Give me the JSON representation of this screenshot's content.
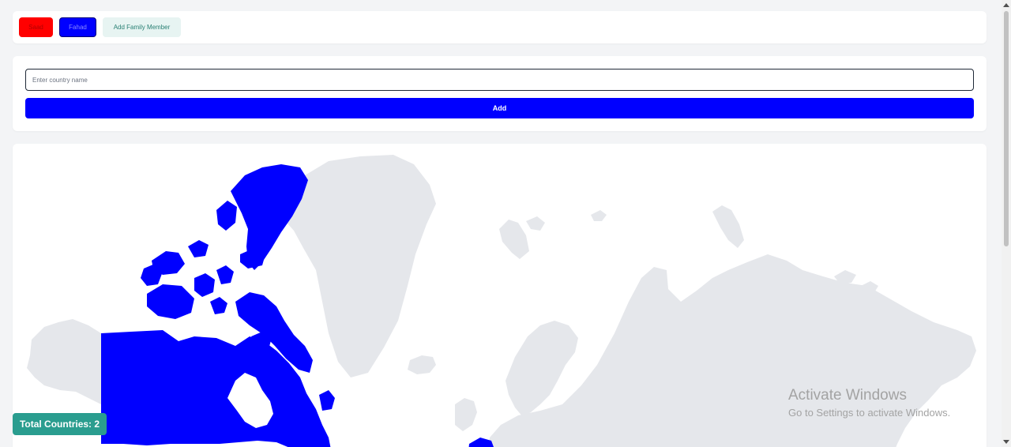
{
  "members": {
    "items": [
      {
        "label": "Saad",
        "color": "#ff0000"
      },
      {
        "label": "Fahad",
        "color": "#0000ff"
      }
    ],
    "add_label": "Add Family Member"
  },
  "country_form": {
    "placeholder": "Enter country name",
    "value": "",
    "add_label": "Add"
  },
  "map": {
    "visited_color": "#0000ff",
    "land_color": "#e5e7eb",
    "visited_countries_shown": [
      "Canada",
      "France"
    ]
  },
  "stats": {
    "total_label": "Total Countries: 2"
  },
  "watermark": {
    "title": "Activate Windows",
    "subtitle": "Go to Settings to activate Windows."
  }
}
